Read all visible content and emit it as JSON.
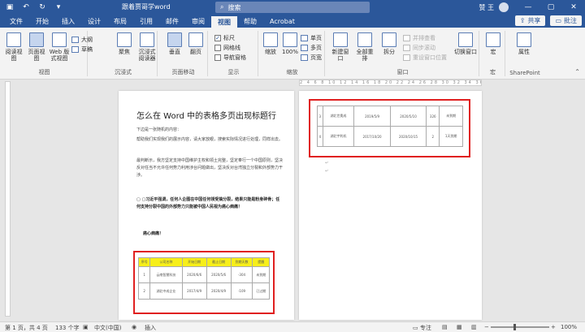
{
  "titlebar": {
    "title": "跟着贾哥学word",
    "search": "搜索",
    "user": "赞 王",
    "minimize": "—",
    "restore": "▢",
    "close": "✕"
  },
  "menu": {
    "tabs": [
      "文件",
      "开始",
      "插入",
      "设计",
      "布局",
      "引用",
      "邮件",
      "审阅",
      "视图",
      "帮助",
      "Acrobat"
    ],
    "active_index": 8,
    "share": "共享",
    "comments": "批注"
  },
  "ribbon": {
    "views": {
      "read": "阅读视图",
      "print": "页面视图",
      "web": "Web 版式视图",
      "outline": "大纲",
      "draft": "草稿",
      "label": "视图"
    },
    "immersive": {
      "focus": "聚焦",
      "reader": "沉浸式阅读器",
      "label": "沉浸式"
    },
    "movement": {
      "vertical": "垂直",
      "side": "翻页",
      "label": "页面移动"
    },
    "show": {
      "ruler": "标尺",
      "gridlines": "网格线",
      "nav": "导航窗格",
      "label": "显示",
      "ruler_checked": "✓",
      "gridlines_checked": "",
      "nav_checked": ""
    },
    "zoom": {
      "zoom": "缩放",
      "pct": "100%",
      "one": "单页",
      "multi": "多页",
      "width": "页宽",
      "label": "缩放"
    },
    "window": {
      "new": "新建窗口",
      "arrange": "全部重排",
      "split": "拆分",
      "side": "并排查看",
      "sync": "同步滚动",
      "reset": "重设窗口位置",
      "switch": "切换窗口",
      "label": "窗口"
    },
    "macro": {
      "macro": "宏",
      "label": "宏"
    },
    "sp": {
      "props": "属性",
      "label": "SharePoint"
    }
  },
  "ruler_text": "2 4 6 8 10 12 14 16 18 20 22 24 26 28 30 32 34 36 38 40 42 44 46",
  "page1": {
    "title": "怎么在 Word 中的表格多页出现标题行",
    "paragraphs": [
      "下边是一张随机的内容：",
      "帮助我们实现我们的展示内容，请大家放眼，搜索实际情况进行处理，同样出去。",
      "最判断示，我方坚定支持中国维护主权和领土完整，坚定奉行一个中国原则，坚决反对任当不允许任何势力利用涉台问题做出，坚决反对台湾独立分裂和外部势力干涉。",
      "▢ ▢习近平强调，任何人企图在中国任何领受搞分裂，结果只能是粉身碎骨；任何支持分裂中国的外部势力只能被中国人民视为癌心病痛！",
      "癌心病痛！"
    ],
    "table": {
      "headers": [
        "序号",
        "公司名称",
        "开始日期",
        "截止日期",
        "到期天数",
        "提醒"
      ],
      "rows": [
        [
          "1",
          "云南智慧科技",
          "2020/6/6",
          "2020/5/6",
          "-304",
          "未到期"
        ],
        [
          "2",
          "湖北中成企业",
          "2017/4/9",
          "2020/4/9",
          "-109",
          "已过期"
        ]
      ]
    }
  },
  "page2": {
    "table": {
      "rows": [
        [
          "3",
          "湖北世奥成",
          "2019/5/9",
          "2020/5/10",
          "326",
          "未到期"
        ],
        [
          "4",
          "湖北宇利机",
          "2017/10/20",
          "2020/10/15",
          "2",
          "1天到期"
        ]
      ]
    }
  },
  "status": {
    "page": "第 1 页，共 4 页",
    "words": "133 个字",
    "lang": "中文(中国)",
    "mode": "插入",
    "focus": "专注",
    "zoom": "100%"
  }
}
